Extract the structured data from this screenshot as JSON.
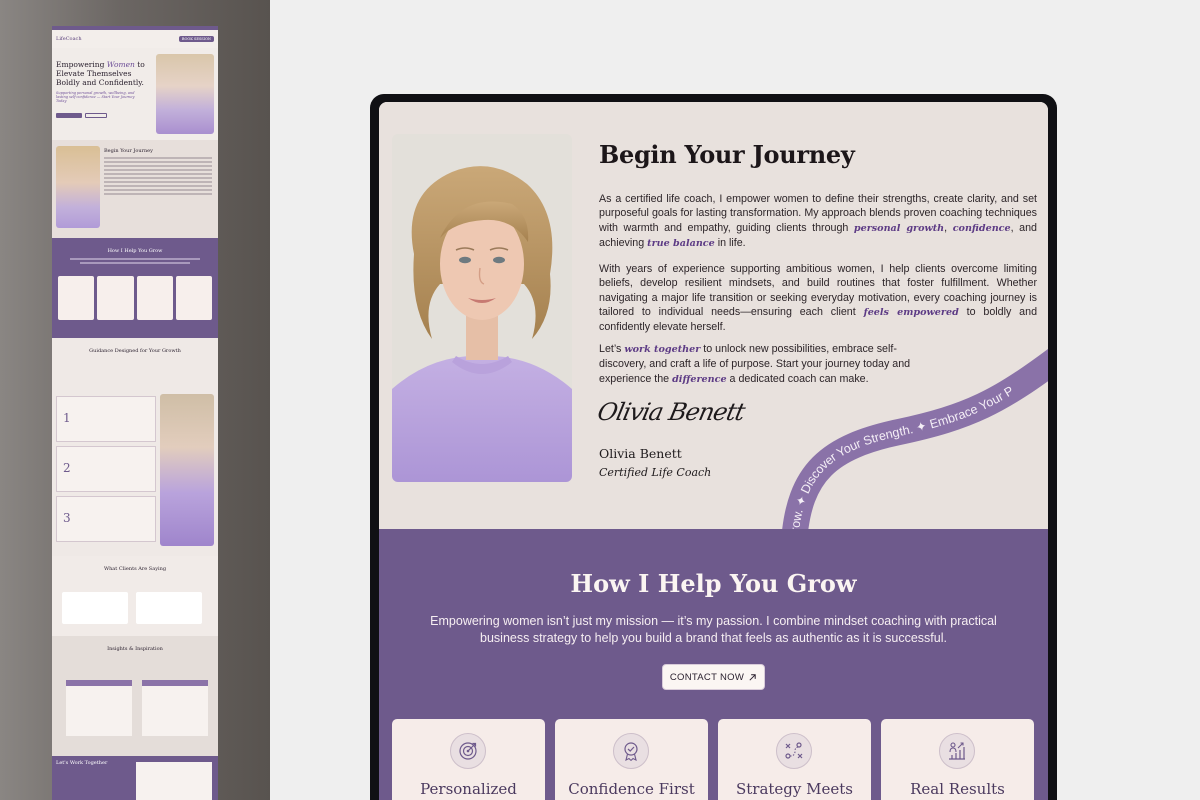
{
  "journey": {
    "title": "Begin Your Journey",
    "p1_a": "As a certified life coach, I empower women to define their strengths, create clarity, and set purposeful goals for lasting transformation. My approach blends proven coaching techniques with warmth and empathy, guiding clients through ",
    "p1_acc1": "personal growth",
    "p1_b": ", ",
    "p1_acc2": "confidence",
    "p1_c": ", and achieving ",
    "p1_acc3": "true balance",
    "p1_d": " in life.",
    "p2_a": "With years of experience supporting ambitious women, I help clients overcome limiting beliefs, develop resilient mindsets, and build routines that foster fulfillment. Whether navigating a major life transition or seeking everyday motivation, every coaching journey is tailored to individual needs—ensuring each client ",
    "p2_acc": "feels empowered",
    "p2_b": " to boldly and confidently elevate herself.",
    "p3_a": "Let’s ",
    "p3_acc1": "work together",
    "p3_b": " to unlock new possibilities, embrace self-discovery, and craft a life of purpose. Start your journey today and experience the ",
    "p3_acc2": "difference",
    "p3_c": " a dedicated coach can make.",
    "signature": "Olivia Benett",
    "name": "Olivia Benett",
    "role": "Certified Life Coach",
    "ribbon_text": "rrow. ✦ Discover Your Strength. ✦ Embrace Your P"
  },
  "grow": {
    "title": "How I Help You Grow",
    "subtitle": "Empowering women isn’t just my mission — it’s my passion. I combine mindset coaching with practical business strategy to help you build a brand that feels as authentic as it is successful.",
    "button_label": "CONTACT NOW",
    "button_icon": "arrow-up-right-icon",
    "cards": [
      {
        "label": "Personalized Approach",
        "icon": "target-icon"
      },
      {
        "label": "Confidence First",
        "icon": "badge-icon"
      },
      {
        "label": "Strategy Meets Soul",
        "icon": "strategy-icon"
      },
      {
        "label": "Real Results",
        "icon": "growth-icon"
      }
    ]
  },
  "preview": {
    "nav_brand": "LifeCoach",
    "nav_cta": "BOOK SESSION",
    "hero_title_a": "Empowering ",
    "hero_title_em": "Women",
    "hero_title_b": " to Elevate Themselves Boldly and Confidently.",
    "hero_sub": "Supporting personal growth, wellbeing, and lasting self-confidence — Start Your Journey Today",
    "begin": "Begin Your Journey",
    "grow": "How I Help You Grow",
    "guidance": "Guidance Designed for Your Growth",
    "clients": "What Clients Are Saying",
    "insights": "Insights & Inspiration",
    "work": "Let's Work Together",
    "numbers": [
      "1",
      "2",
      "3"
    ]
  },
  "colors": {
    "accent": "#6e5a8c",
    "accent_text": "#5d3b85",
    "section_bg": "#e8e1dd",
    "card_bg": "#f6ece9"
  }
}
